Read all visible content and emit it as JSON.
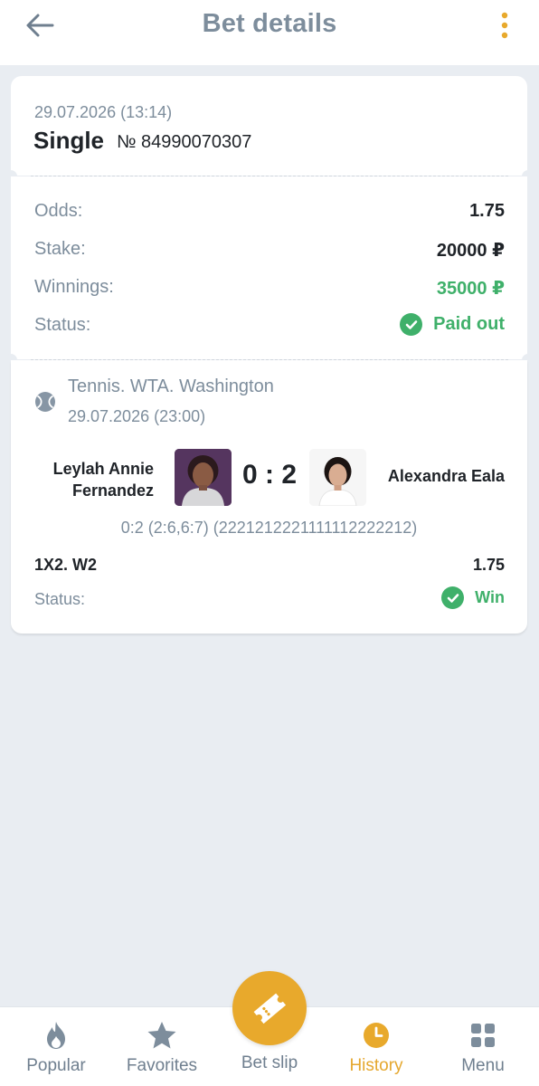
{
  "header": {
    "title": "Bet details",
    "back_icon": "arrow-left-icon",
    "menu_icon": "more-vertical-icon"
  },
  "bet": {
    "datetime": "29.07.2026 (13:14)",
    "type": "Single",
    "number": "№ 84990070307"
  },
  "summary": {
    "odds_label": "Odds:",
    "odds_value": "1.75",
    "stake_label": "Stake:",
    "stake_value": "20000 ₽",
    "winnings_label": "Winnings:",
    "winnings_value": "35000 ₽",
    "status_label": "Status:",
    "status_value": "Paid out"
  },
  "event": {
    "league": "Tennis. WTA. Washington",
    "datetime": "29.07.2026 (23:00)",
    "player1": "Leylah Annie Fernandez",
    "player2": "Alexandra Eala",
    "score": "0 : 2",
    "detailed_score": "0:2 (2:6,6:7) (2221212221111112222212)",
    "market": "1X2. W2",
    "market_odds": "1.75",
    "status_label": "Status:",
    "status_value": "Win"
  },
  "nav": {
    "popular": "Popular",
    "favorites": "Favorites",
    "betslip": "Bet slip",
    "history": "History",
    "menu": "Menu",
    "active": "history"
  },
  "colors": {
    "accent": "#e8a92c",
    "success": "#3fb06a",
    "muted": "#7d8d9c",
    "background": "#e9edf2"
  }
}
